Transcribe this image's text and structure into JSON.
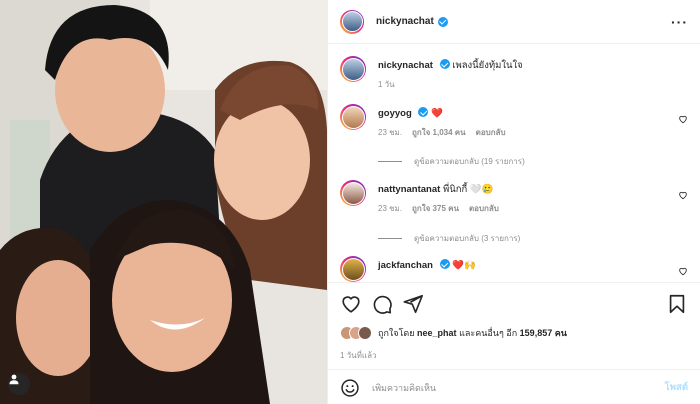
{
  "post": {
    "username": "nickynachat",
    "caption_user": "nickynachat",
    "caption_text": "เพลงนี้ยังทุ้มในใจ",
    "caption_time": "1 วัน"
  },
  "comments": [
    {
      "user": "goyyog",
      "verified": true,
      "text": "❤️",
      "time": "23 ชม.",
      "likes": "ถูกใจ 1,034 คน",
      "reply": "ตอบกลับ",
      "view_replies": "ดูข้อความตอบกลับ (19 รายการ)"
    },
    {
      "user": "nattynantanat",
      "verified": false,
      "text": "พี่นิกกี้ 🤍🥲",
      "time": "23 ชม.",
      "likes": "ถูกใจ 375 คน",
      "reply": "ตอบกลับ",
      "view_replies": "ดูข้อความตอบกลับ (3 รายการ)"
    },
    {
      "user": "jackfanchan",
      "verified": true,
      "text": "❤️🙌"
    }
  ],
  "likes": {
    "prefix": "ถูกใจโดย",
    "user": "nee_phat",
    "middle": "และคนอื่นๆ อีก",
    "count": "159,857 คน"
  },
  "posted_ago": "1 วันที่แล้ว",
  "comment_input": {
    "placeholder": "เพิ่มความคิดเห็น",
    "post_label": "โพสต์"
  },
  "icons": {
    "like": "heart-icon",
    "comment": "comment-icon",
    "share": "share-icon",
    "save": "bookmark-icon",
    "emoji": "emoji-icon",
    "tag": "user-tag-icon",
    "more": "more-options-icon"
  },
  "colors": {
    "verified": "#1d9bf0",
    "post_button_disabled": "#b2dffc",
    "muted_text": "#8e8e8e",
    "heart_red": "#ed1c3b"
  }
}
